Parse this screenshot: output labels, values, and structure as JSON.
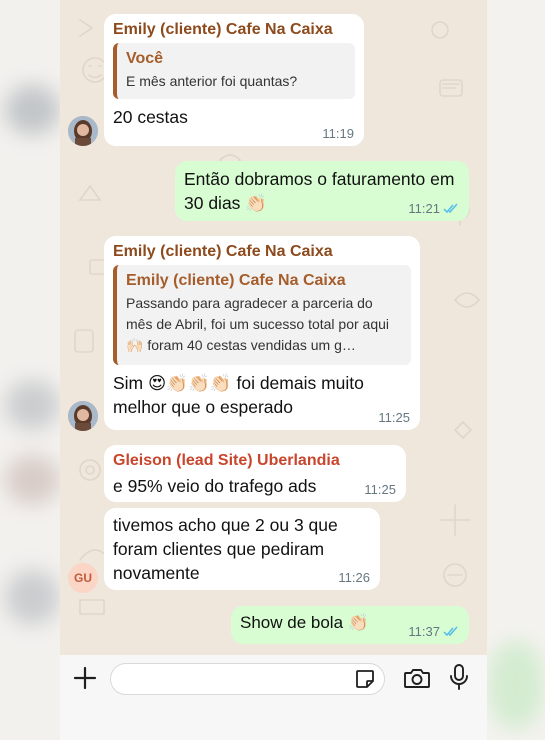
{
  "messages": {
    "m1": {
      "sender": "Emily (cliente) Cafe Na Caixa",
      "quote_name": "Você",
      "quote_text": "E mês anterior foi quantas?",
      "text": "20 cestas",
      "time": "11:19"
    },
    "m2": {
      "text": "Então dobramos o faturamento em 30 dias 👏🏻",
      "time": "11:21",
      "status": "read"
    },
    "m3": {
      "sender": "Emily (cliente) Cafe Na Caixa",
      "quote_name": "Emily (cliente) Cafe Na Caixa",
      "quote_text": "Passando para agradecer a parceria do mês de Abril, foi um sucesso total por aqui 🙌🏻 foram 40 cestas vendidas um g…",
      "text": "Sim 😍👏🏻👏🏻👏🏻 foi demais muito melhor que o esperado",
      "time": "11:25"
    },
    "m4": {
      "sender": "Gleison (lead Site) Uberlandia",
      "text": "e 95% veio do trafego ads",
      "time": "11:25"
    },
    "m5": {
      "text": "tivemos acho que 2 ou 3 que foram clientes que pediram novamente",
      "time": "11:26",
      "avatar_initials": "GU"
    },
    "m6": {
      "text": "Show de bola 👏🏻",
      "time": "11:37",
      "status": "read"
    }
  },
  "composer": {
    "placeholder": ""
  },
  "icons": [
    "plus-icon",
    "sticker-icon",
    "camera-icon",
    "microphone-icon",
    "double-check-icon"
  ],
  "colors": {
    "wallpaper": "#efe7dc",
    "outgoing": "#d8fdd2",
    "incoming": "#ffffff",
    "sender_brown": "#8d4a1c",
    "sender_red": "#c8462c",
    "read_ticks": "#53bdeb"
  }
}
